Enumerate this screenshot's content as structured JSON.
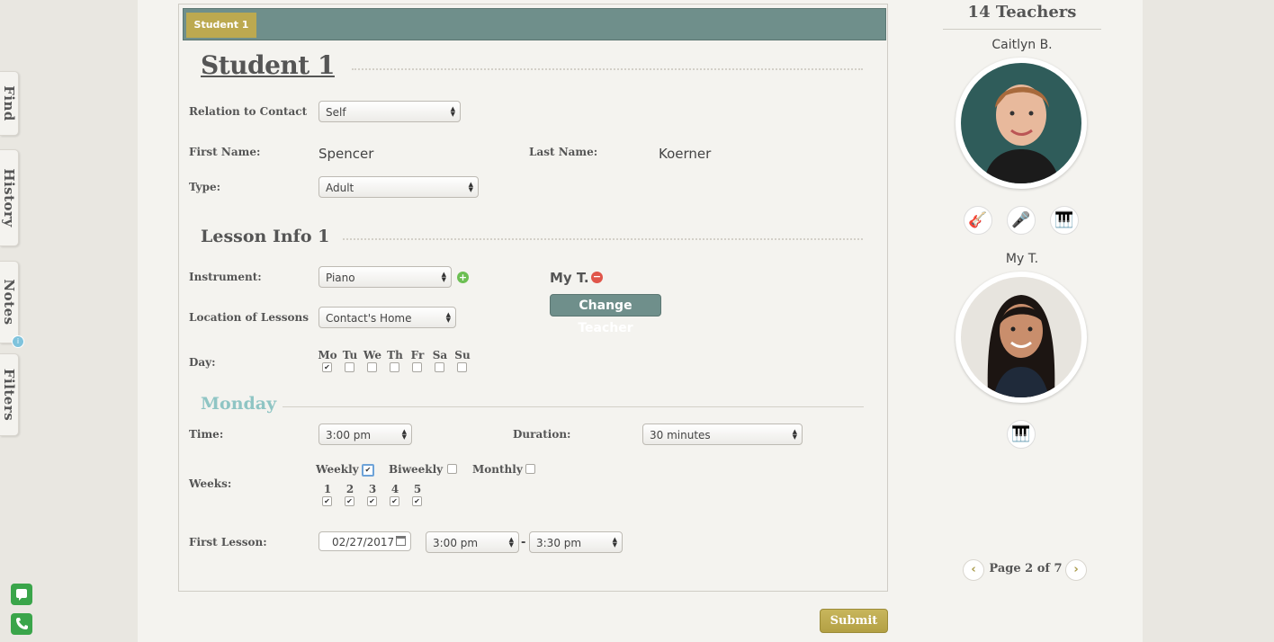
{
  "side_tabs": [
    "Find",
    "History",
    "Notes",
    "Filters"
  ],
  "notes_badge": "i",
  "form": {
    "tab_label": "Student 1",
    "student_heading": "Student 1",
    "relation_label": "Relation to Contact",
    "relation_value": "Self",
    "first_name_label": "First Name:",
    "first_name_value": "Spencer",
    "last_name_label": "Last Name:",
    "last_name_value": "Koerner",
    "type_label": "Type:",
    "type_value": "Adult",
    "lesson_heading": "Lesson Info 1",
    "instrument_label": "Instrument:",
    "instrument_value": "Piano",
    "location_label": "Location of Lessons",
    "location_value": "Contact's Home",
    "day_label": "Day:",
    "days": [
      {
        "label": "Mo",
        "checked": true
      },
      {
        "label": "Tu",
        "checked": false
      },
      {
        "label": "We",
        "checked": false
      },
      {
        "label": "Th",
        "checked": false
      },
      {
        "label": "Fr",
        "checked": false
      },
      {
        "label": "Sa",
        "checked": false
      },
      {
        "label": "Su",
        "checked": false
      }
    ],
    "teacher_selected": "My T.",
    "change_teacher_label": "Change Teacher",
    "monday_heading": "Monday",
    "time_label": "Time:",
    "time_value": "3:00 pm",
    "duration_label": "Duration:",
    "duration_value": "30 minutes",
    "weeks_label": "Weeks:",
    "frequency": [
      {
        "label": "Weekly",
        "checked": true
      },
      {
        "label": "Biweekly",
        "checked": false
      },
      {
        "label": "Monthly",
        "checked": false
      }
    ],
    "week_numbers": [
      {
        "label": "1",
        "checked": true
      },
      {
        "label": "2",
        "checked": true
      },
      {
        "label": "3",
        "checked": true
      },
      {
        "label": "4",
        "checked": true
      },
      {
        "label": "5",
        "checked": true
      }
    ],
    "first_lesson_label": "First Lesson:",
    "first_lesson_date": "02/27/2017",
    "first_lesson_start": "3:00 pm",
    "first_lesson_dash": "-",
    "first_lesson_end": "3:30 pm",
    "submit_label": "Submit"
  },
  "teachers": {
    "heading": "14 Teachers",
    "list": [
      {
        "name": "Caitlyn B.",
        "instruments": [
          "guitar-icon",
          "microphone-icon",
          "piano-icon"
        ]
      },
      {
        "name": "My T.",
        "instruments": [
          "piano-icon"
        ]
      }
    ],
    "page_label": "Page 2 of 7",
    "prev_symbol": "‹",
    "next_symbol": "›"
  },
  "colors": {
    "accent_teal": "#6f8f8b",
    "accent_gold": "#bca950",
    "monday_teal": "#8fc5c4"
  }
}
